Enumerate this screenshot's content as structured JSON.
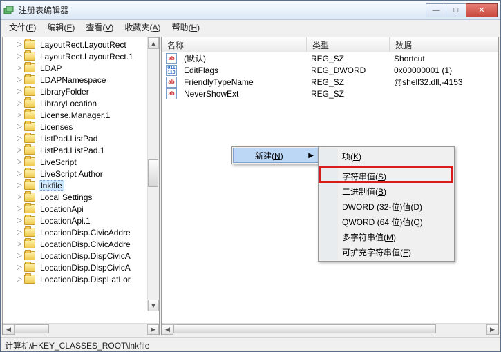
{
  "window": {
    "title": "注册表编辑器",
    "buttons": {
      "min": "—",
      "max": "□",
      "close": "✕"
    }
  },
  "menubar": [
    {
      "label": "文件",
      "accel": "F"
    },
    {
      "label": "编辑",
      "accel": "E"
    },
    {
      "label": "查看",
      "accel": "V"
    },
    {
      "label": "收藏夹",
      "accel": "A"
    },
    {
      "label": "帮助",
      "accel": "H"
    }
  ],
  "tree": {
    "items": [
      "LayoutRect.LayoutRect",
      "LayoutRect.LayoutRect.1",
      "LDAP",
      "LDAPNamespace",
      "LibraryFolder",
      "LibraryLocation",
      "License.Manager.1",
      "Licenses",
      "ListPad.ListPad",
      "ListPad.ListPad.1",
      "LiveScript",
      "LiveScript Author",
      "lnkfile",
      "Local Settings",
      "LocationApi",
      "LocationApi.1",
      "LocationDisp.CivicAddre",
      "LocationDisp.CivicAddre",
      "LocationDisp.DispCivicA",
      "LocationDisp.DispCivicA",
      "LocationDisp.DispLatLor"
    ],
    "selected": "lnkfile"
  },
  "list": {
    "columns": {
      "name": "名称",
      "type": "类型",
      "data": "数据"
    },
    "rows": [
      {
        "icon": "sz",
        "name": "(默认)",
        "type": "REG_SZ",
        "data": "Shortcut"
      },
      {
        "icon": "dw",
        "name": "EditFlags",
        "type": "REG_DWORD",
        "data": "0x00000001 (1)"
      },
      {
        "icon": "sz",
        "name": "FriendlyTypeName",
        "type": "REG_SZ",
        "data": "@shell32.dll,-4153"
      },
      {
        "icon": "sz",
        "name": "NeverShowExt",
        "type": "REG_SZ",
        "data": ""
      }
    ]
  },
  "context": {
    "parent_label": "新建",
    "parent_accel": "N",
    "sub": [
      {
        "label": "项",
        "accel": "K"
      },
      {
        "label": "字符串值",
        "accel": "S",
        "highlight": true
      },
      {
        "label": "二进制值",
        "accel": "B"
      },
      {
        "label": "DWORD (32-位)值",
        "accel": "D"
      },
      {
        "label": "QWORD (64 位)值",
        "accel": "Q"
      },
      {
        "label": "多字符串值",
        "accel": "M"
      },
      {
        "label": "可扩充字符串值",
        "accel": "E"
      }
    ]
  },
  "statusbar": "计算机\\HKEY_CLASSES_ROOT\\lnkfile"
}
